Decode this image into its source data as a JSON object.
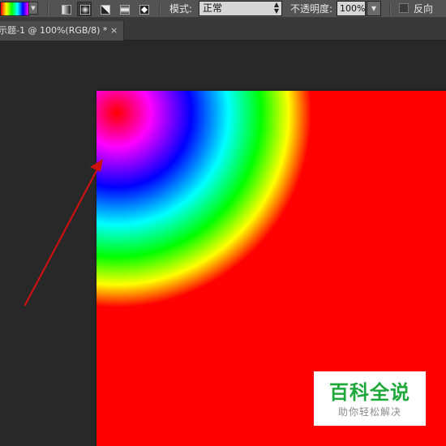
{
  "options_bar": {
    "gradient_types": [
      {
        "name": "linear",
        "active": false
      },
      {
        "name": "radial",
        "active": true
      },
      {
        "name": "angle",
        "active": false
      },
      {
        "name": "reflected",
        "active": false
      },
      {
        "name": "diamond",
        "active": false
      }
    ],
    "mode_label": "模式:",
    "mode_value": "正常",
    "opacity_label": "不透明度:",
    "opacity_value": "100%",
    "reverse_label": "反向",
    "reverse_checked": false
  },
  "document_tab": {
    "title": "示题-1 @ 100%(RGB/8) *",
    "close_glyph": "×"
  },
  "canvas": {
    "background_color": "#ff0000",
    "gradient_colors": [
      "#ff0000",
      "#ff00ff",
      "#0000ff",
      "#00ffff",
      "#00ff00",
      "#ffff00",
      "#ff0000"
    ],
    "annotation_arrow_color": "#cc1111"
  },
  "watermark": {
    "title": "百科全说",
    "subtitle": "助你轻松解决"
  }
}
